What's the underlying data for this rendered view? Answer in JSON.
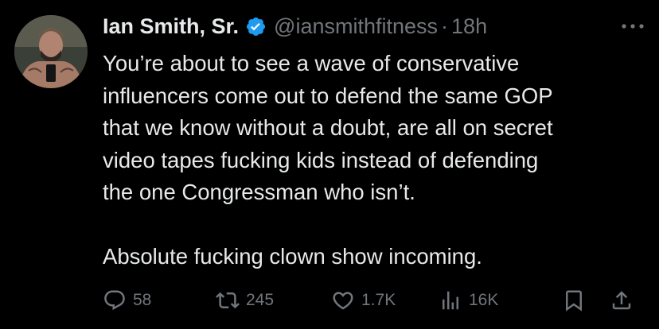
{
  "author": {
    "display_name": "Ian Smith, Sr.",
    "handle": "@iansmithfitness",
    "separator": "·",
    "time": "18h",
    "verified": true
  },
  "tweet": {
    "paragraphs": [
      "You’re about to see a wave of conservative\ninfluencers come out to defend the same GOP\nthat we know without a doubt, are all on secret\nvideo tapes fucking kids instead of defending\nthe one Congressman who isn’t.",
      "Absolute fucking clown show incoming."
    ]
  },
  "actions": {
    "replies": "58",
    "reposts": "245",
    "likes": "1.7K",
    "views": "16K"
  },
  "icons": {
    "more": "more-horizontal-icon",
    "reply": "reply-bubble-icon",
    "repost": "repost-arrows-icon",
    "like": "heart-icon",
    "views": "bar-chart-icon",
    "bookmark": "bookmark-icon",
    "share": "share-upload-icon",
    "verified": "verified-badge-icon"
  },
  "colors": {
    "background": "#000000",
    "text": "#e7e9ea",
    "secondary": "#71767b",
    "verified": "#1d9bf0"
  }
}
